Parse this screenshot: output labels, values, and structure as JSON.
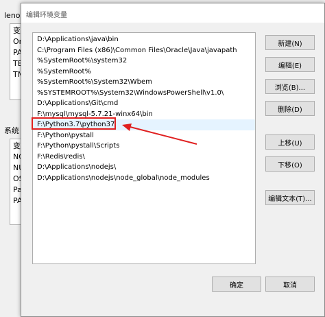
{
  "background_window": {
    "user_label_fragment": "leno",
    "user_vars": [
      "变",
      "On",
      "PA",
      "TE",
      "TM"
    ],
    "system_label_fragment": "系统",
    "system_vars": [
      "变",
      "NC",
      "NU",
      "OS",
      "Pa",
      "PA"
    ]
  },
  "dialog": {
    "title": "编辑环境变量",
    "paths": [
      "D:\\Applications\\java\\bin",
      "C:\\Program Files (x86)\\Common Files\\Oracle\\Java\\javapath",
      "%SystemRoot%\\system32",
      "%SystemRoot%",
      "%SystemRoot%\\System32\\Wbem",
      "%SYSTEMROOT%\\System32\\WindowsPowerShell\\v1.0\\",
      "D:\\Applications\\Git\\cmd",
      "F:\\mysql\\mysql-5.7.21-winx64\\bin",
      "F:\\Python3.7\\python37",
      "F:\\Python\\pystall",
      "F:\\Python\\pystall\\Scripts",
      "F:\\Redis\\redis\\",
      "D:\\Applications\\nodejs\\",
      "D:\\Applications\\nodejs\\node_global\\node_modules"
    ],
    "selected_index": 8,
    "buttons": {
      "new": "新建(N)",
      "edit": "编辑(E)",
      "browse": "浏览(B)...",
      "delete": "删除(D)",
      "move_up": "上移(U)",
      "move_down": "下移(O)",
      "edit_text": "编辑文本(T)...",
      "ok": "确定",
      "cancel": "取消"
    }
  },
  "annotation": {
    "color": "#e02020"
  }
}
